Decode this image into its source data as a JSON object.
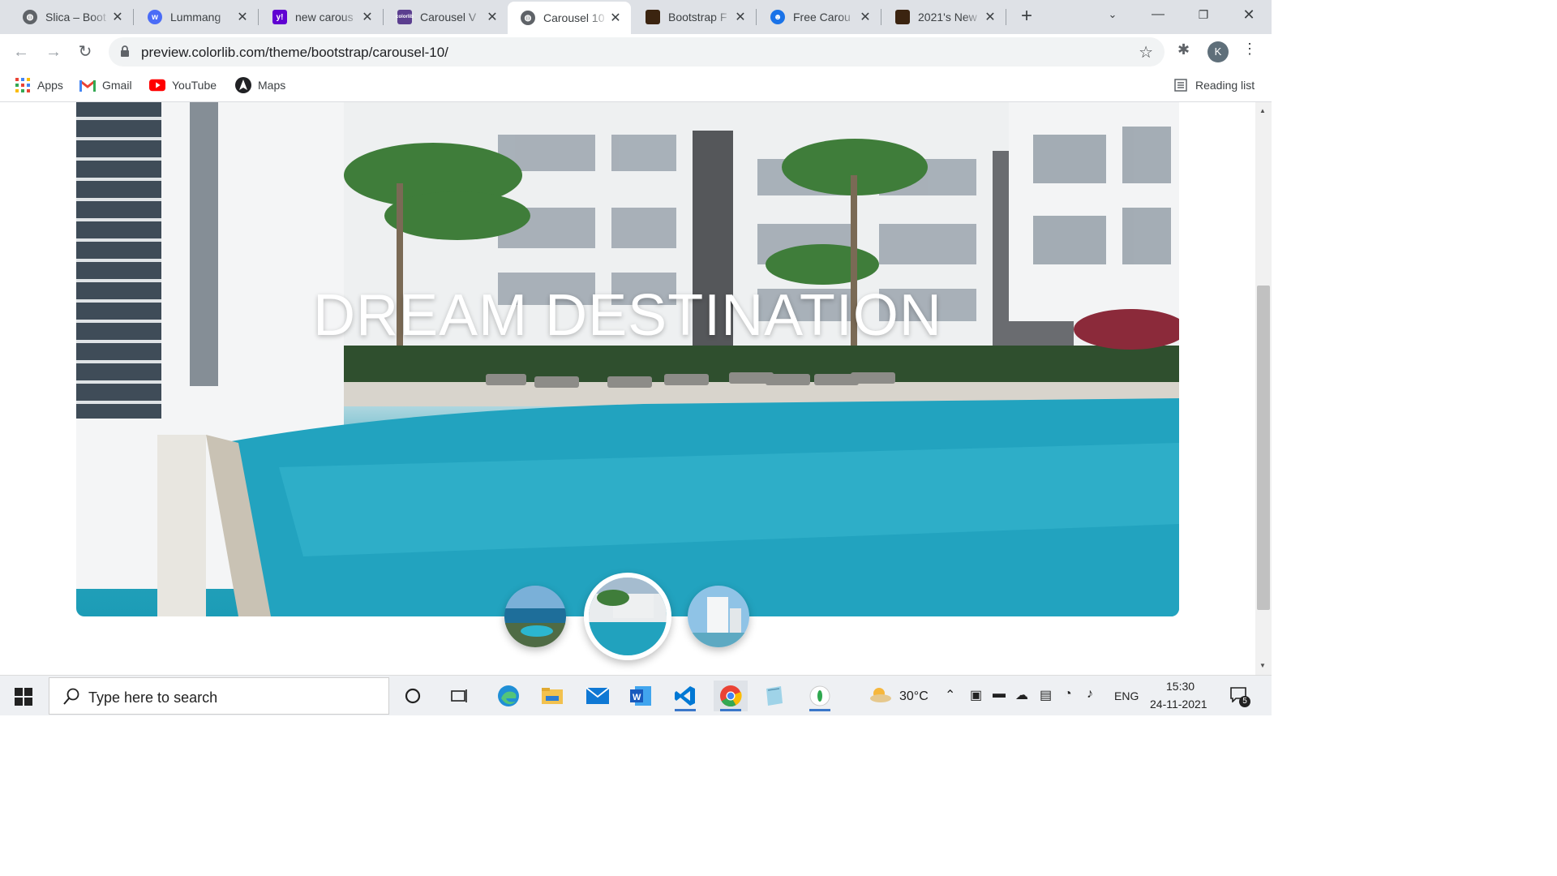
{
  "tabs": [
    {
      "title": "Slica – Boot",
      "favicon": "globe-icon",
      "color": "#5f6368"
    },
    {
      "title": "Lummang",
      "favicon": "w-logo-icon",
      "color": "#4a6cf7"
    },
    {
      "title": "new carous",
      "favicon": "yahoo-icon",
      "color": "#6001d2"
    },
    {
      "title": "Carousel V",
      "favicon": "colorlib-icon",
      "color": "#5b3e8f"
    },
    {
      "title": "Carousel 10",
      "favicon": "globe-icon",
      "color": "#5f6368",
      "active": true
    },
    {
      "title": "Bootstrap F",
      "favicon": "image-icon",
      "color": "#3b2410"
    },
    {
      "title": "Free Carou",
      "favicon": "bot-icon",
      "color": "#1a73e8"
    },
    {
      "title": "2021's New",
      "favicon": "image-icon",
      "color": "#3b2410"
    }
  ],
  "toolbar": {
    "url": "preview.colorlib.com/theme/bootstrap/carousel-10/",
    "profile_initial": "K"
  },
  "bookmarks": [
    {
      "label": "Apps",
      "icon": "apps-grid-icon"
    },
    {
      "label": "Gmail",
      "icon": "gmail-icon"
    },
    {
      "label": "YouTube",
      "icon": "youtube-icon"
    },
    {
      "label": "Maps",
      "icon": "maps-icon"
    }
  ],
  "reading_list": "Reading list",
  "hero": {
    "caption": "DREAM DESTINATION",
    "thumbnails": [
      {
        "name": "thumb-1",
        "active": false
      },
      {
        "name": "thumb-2",
        "active": true
      },
      {
        "name": "thumb-3",
        "active": false
      }
    ]
  },
  "taskbar": {
    "search_placeholder": "Type here to search",
    "weather": "30°C",
    "language": "ENG",
    "time": "15:30",
    "date": "24-11-2021",
    "notifications": "5"
  }
}
